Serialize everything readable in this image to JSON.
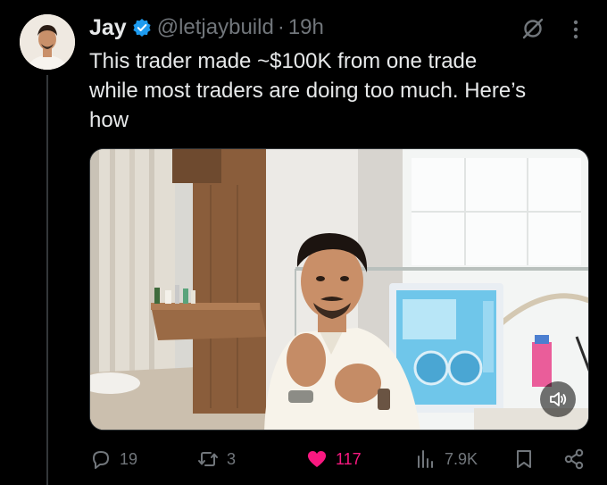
{
  "tweet": {
    "author_name": "Jay",
    "handle": "@letjaybuild",
    "separator": "·",
    "time": "19h",
    "text_lines": [
      "This trader made ~$100K from one trade",
      "while most traders are doing too much. Here’s",
      "how"
    ]
  },
  "media": {
    "type": "video",
    "volume_icon": "volume-icon"
  },
  "actions": {
    "replies": "19",
    "reposts": "3",
    "likes": "117",
    "views": "7.9K"
  },
  "colors": {
    "background": "#000000",
    "text": "#e7e9ea",
    "muted": "#71767b",
    "verified": "#1d9bf0",
    "like": "#f91880",
    "thread_line": "#333639"
  },
  "icons": [
    "verified-badge-icon",
    "grok-icon",
    "more-icon",
    "reply-icon",
    "repost-icon",
    "heart-icon",
    "views-icon",
    "bookmark-icon",
    "share-icon",
    "volume-icon"
  ]
}
